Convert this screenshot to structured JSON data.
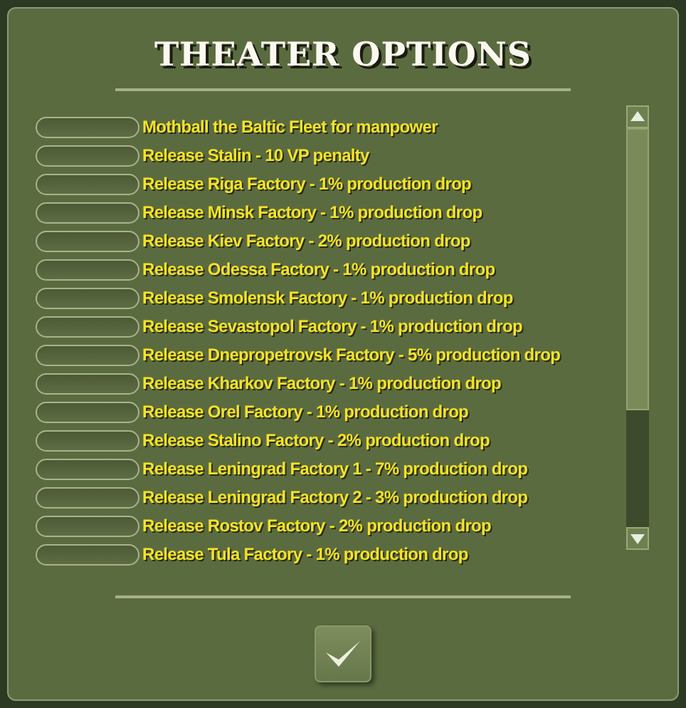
{
  "title": "THEATER OPTIONS",
  "options": [
    {
      "label": "Mothball the Baltic Fleet for manpower",
      "on": false
    },
    {
      "label": "Release Stalin - 10 VP penalty",
      "on": false
    },
    {
      "label": "Release Riga Factory - 1% production drop",
      "on": false
    },
    {
      "label": "Release Minsk Factory - 1% production drop",
      "on": false
    },
    {
      "label": "Release Kiev Factory - 2% production drop",
      "on": false
    },
    {
      "label": "Release Odessa Factory - 1% production drop",
      "on": false
    },
    {
      "label": "Release Smolensk Factory - 1% production drop",
      "on": false
    },
    {
      "label": "Release Sevastopol Factory - 1% production drop",
      "on": false
    },
    {
      "label": "Release Dnepropetrovsk Factory - 5% production drop",
      "on": false
    },
    {
      "label": "Release Kharkov Factory - 1% production drop",
      "on": false
    },
    {
      "label": "Release Orel Factory - 1% production drop",
      "on": false
    },
    {
      "label": "Release Stalino Factory - 2% production drop",
      "on": false
    },
    {
      "label": "Release Leningrad Factory 1 - 7% production drop",
      "on": false
    },
    {
      "label": "Release Leningrad Factory 2 - 3% production drop",
      "on": false
    },
    {
      "label": "Release Rostov Factory - 2% production drop",
      "on": false
    },
    {
      "label": "Release Tula Factory - 1% production drop",
      "on": false
    }
  ]
}
